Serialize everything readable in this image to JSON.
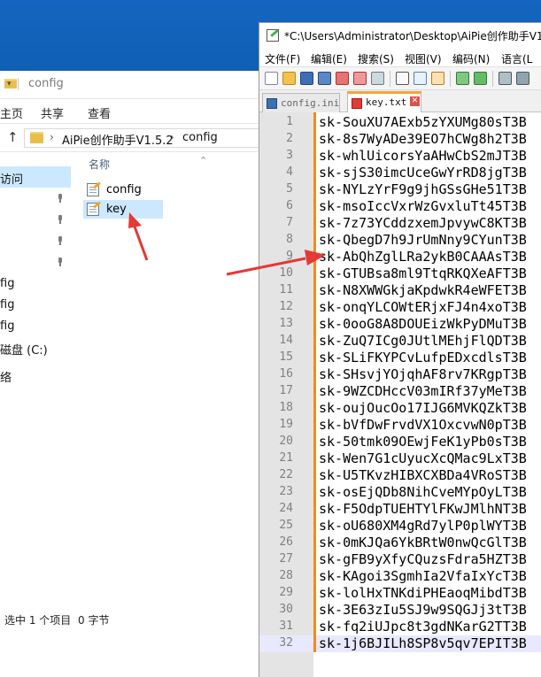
{
  "explorer": {
    "window_title": "config",
    "ribbon_tabs": [
      "主页",
      "共享",
      "查看"
    ],
    "address": {
      "crumbs": [
        "AiPie创作助手V1.5.2",
        "config"
      ]
    },
    "nav_items": [
      {
        "label": "访问",
        "selected": true
      },
      {
        "label": "fig"
      },
      {
        "label": "fig"
      },
      {
        "label": "fig"
      },
      {
        "label": "磁盘 (C:)"
      },
      {
        "label": "络"
      }
    ],
    "column_header": "名称",
    "files": [
      {
        "name": "config",
        "selected": false
      },
      {
        "name": "key",
        "selected": true
      }
    ],
    "status": {
      "selection": "选中 1 个项目",
      "size": "0 字节"
    }
  },
  "notepad": {
    "title": "*C:\\Users\\Administrator\\Desktop\\AiPie创作助手V1.",
    "menu": [
      "文件(F)",
      "编辑(E)",
      "搜索(S)",
      "视图(V)",
      "编码(N)",
      "语言(L"
    ],
    "tabs": [
      {
        "label": "config.ini",
        "active": false
      },
      {
        "label": "key.txt",
        "active": true
      }
    ],
    "lines": [
      {
        "n": "1",
        "text": "sk-SouXU7AExb5zYXUMg80sT3B"
      },
      {
        "n": "2",
        "text": "sk-8s7WyADe39EO7hCWg8h2T3B"
      },
      {
        "n": "3",
        "text": "sk-whlUicorsYaAHwCbS2mJT3B"
      },
      {
        "n": "4",
        "text": "sk-sjS30imcUceGwYrRD8jgT3B"
      },
      {
        "n": "5",
        "text": "sk-NYLzYrF9g9jhGSsGHe51T3B"
      },
      {
        "n": "6",
        "text": "sk-msoIccVxrWzGvxluTt45T3B"
      },
      {
        "n": "7",
        "text": "sk-7z73YCddzxemJpvywC8KT3B"
      },
      {
        "n": "8",
        "text": "sk-QbegD7h9JrUmNny9CYunT3B"
      },
      {
        "n": "9",
        "text": "sk-AbQhZglLRa2ykB0CAAAsT3B"
      },
      {
        "n": "10",
        "text": "sk-GTUBsa8ml9TtqRKQXeAFT3B"
      },
      {
        "n": "11",
        "text": "sk-N8XWWGkjaKpdwkR4eWFET3B"
      },
      {
        "n": "12",
        "text": "sk-onqYLCOWtERjxFJ4n4xoT3B"
      },
      {
        "n": "13",
        "text": "sk-0ooG8A8DOUEizWkPyDMuT3B"
      },
      {
        "n": "14",
        "text": "sk-ZuQ7ICg0JUtlMEhjFlQDT3B"
      },
      {
        "n": "15",
        "text": "sk-SLiFKYPCvLufpEDxcdlsT3B"
      },
      {
        "n": "16",
        "text": "sk-SHsvjYOjqhAF8rv7KRgpT3B"
      },
      {
        "n": "17",
        "text": "sk-9WZCDHccV03mIRf37yMeT3B"
      },
      {
        "n": "18",
        "text": "sk-oujOucOo17IJG6MVKQZkT3B"
      },
      {
        "n": "19",
        "text": "sk-bVfDwFrvdVX1OxcvwN0pT3B"
      },
      {
        "n": "20",
        "text": "sk-50tmk09OEwjFeK1yPb0sT3B"
      },
      {
        "n": "21",
        "text": "sk-Wen7G1cUyucXcQMac9LxT3B"
      },
      {
        "n": "22",
        "text": "sk-U5TKvzHIBXCXBDa4VRoST3B"
      },
      {
        "n": "23",
        "text": "sk-osEjQDb8NihCveMYpOyLT3B"
      },
      {
        "n": "24",
        "text": "sk-F5OdpTUEHTYlFKwJMlhNT3B"
      },
      {
        "n": "25",
        "text": "sk-oU680XM4gRd7ylP0plWYT3B"
      },
      {
        "n": "26",
        "text": "sk-0mKJQa6YkBRtW0nwQcGlT3B"
      },
      {
        "n": "27",
        "text": "sk-gFB9yXfyCQuzsFdra5HZT3B"
      },
      {
        "n": "28",
        "text": "sk-KAgoi3SgmhIa2VfaIxYcT3B"
      },
      {
        "n": "29",
        "text": "sk-lolHxTNKdiPHEaoqMibdT3B"
      },
      {
        "n": "30",
        "text": "sk-3E63zIu5SJ9w9SQGJj3tT3B"
      },
      {
        "n": "31",
        "text": "sk-fq2iUJpc8t3gdNKarG2TT3B"
      },
      {
        "n": "32",
        "text": "sk-1j6BJILh8SP8v5qv7EPIT3B"
      }
    ],
    "current_line": 32
  },
  "colors": {
    "desktop": "#1565c0",
    "selection": "#cce8ff",
    "change_bar": "#f28a1c",
    "arrow": "#e53935"
  }
}
